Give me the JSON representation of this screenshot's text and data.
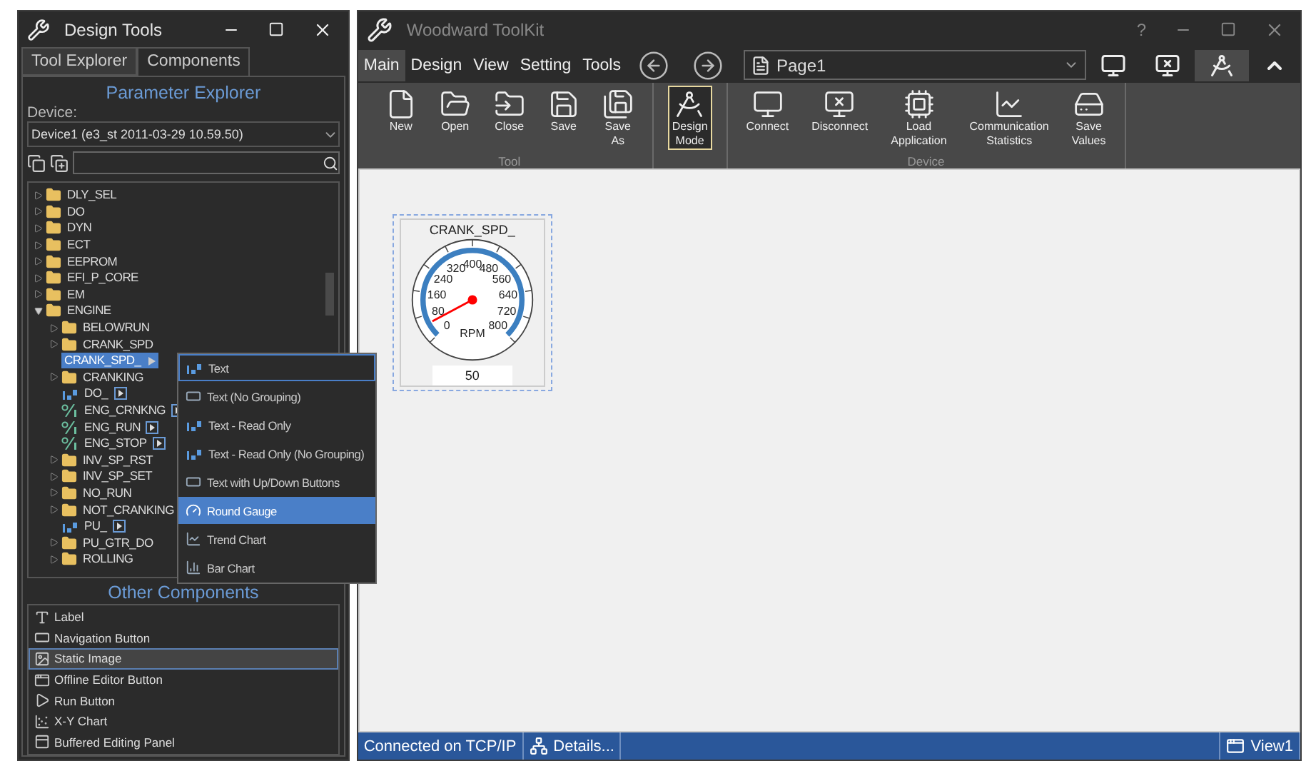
{
  "design_tools": {
    "title": "Design Tools",
    "tabs": [
      {
        "label": "Tool Explorer",
        "selected": false
      },
      {
        "label": "Components",
        "selected": true
      }
    ],
    "heading": "Parameter Explorer",
    "device_label": "Device:",
    "device": "Device1 (e3_st 2011-03-29 10.59.50)",
    "tree": [
      {
        "label": "DLY_SEL",
        "kind": "folder",
        "expanded": false,
        "selected": false
      },
      {
        "label": "DO",
        "kind": "folder",
        "expanded": false,
        "selected": false
      },
      {
        "label": "DYN",
        "kind": "folder",
        "expanded": false,
        "selected": false
      },
      {
        "label": "ECT",
        "kind": "folder",
        "expanded": false,
        "selected": false
      },
      {
        "label": "EEPROM",
        "kind": "folder",
        "expanded": false,
        "selected": false
      },
      {
        "label": "EFI_P_CORE",
        "kind": "folder",
        "expanded": false,
        "selected": false
      },
      {
        "label": "EM",
        "kind": "folder",
        "expanded": false,
        "selected": false
      },
      {
        "label": "ENGINE",
        "kind": "folder",
        "expanded": true,
        "selected": false,
        "children": [
          {
            "label": "BELOWRUN",
            "kind": "folder",
            "expanded": false,
            "selected": false
          },
          {
            "label": "CRANK_SPD",
            "kind": "folder",
            "expanded": false,
            "selected": false
          },
          {
            "label": "CRANK_SPD_",
            "kind": "numeric",
            "selected": true
          },
          {
            "label": "CRANKING",
            "kind": "folder",
            "expanded": false,
            "selected": false
          },
          {
            "label": "DO_",
            "kind": "numeric",
            "selected": false
          },
          {
            "label": "ENG_CRNKNG",
            "kind": "boolean",
            "selected": false
          },
          {
            "label": "ENG_RUN",
            "kind": "boolean",
            "selected": false
          },
          {
            "label": "ENG_STOP",
            "kind": "boolean",
            "selected": false
          },
          {
            "label": "INV_SP_RST",
            "kind": "folder",
            "expanded": false,
            "selected": false
          },
          {
            "label": "INV_SP_SET",
            "kind": "folder",
            "expanded": false,
            "selected": false
          },
          {
            "label": "NO_RUN",
            "kind": "folder",
            "expanded": false,
            "selected": false
          },
          {
            "label": "NOT_CRANKING",
            "kind": "folder",
            "expanded": false,
            "selected": false
          },
          {
            "label": "PU_",
            "kind": "numeric",
            "selected": false
          },
          {
            "label": "PU_GTR_DO",
            "kind": "folder",
            "expanded": false,
            "selected": false
          },
          {
            "label": "ROLLING",
            "kind": "folder",
            "expanded": false,
            "selected": false
          }
        ]
      }
    ],
    "context_menu": [
      {
        "label": "Text",
        "kind": "numeric",
        "selected": false,
        "focused": true
      },
      {
        "label": "Text (No Grouping)",
        "kind": "field",
        "selected": false,
        "focused": false
      },
      {
        "label": "Text - Read Only",
        "kind": "numeric",
        "selected": false,
        "focused": false
      },
      {
        "label": "Text - Read Only (No Grouping)",
        "kind": "numeric",
        "selected": false,
        "focused": false
      },
      {
        "label": "Text with Up/Down Buttons",
        "kind": "field",
        "selected": false,
        "focused": false
      },
      {
        "label": "Round Gauge",
        "kind": "gauge",
        "selected": true,
        "focused": false
      },
      {
        "label": "Trend Chart",
        "kind": "trend",
        "selected": false,
        "focused": false
      },
      {
        "label": "Bar Chart",
        "kind": "bar",
        "selected": false,
        "focused": false
      }
    ],
    "other_heading": "Other Components",
    "other_components": [
      {
        "label": "Label",
        "kind": "label",
        "selected": false
      },
      {
        "label": "Navigation Button",
        "kind": "nav",
        "selected": false
      },
      {
        "label": "Static Image",
        "kind": "image",
        "selected": true
      },
      {
        "label": "Offline Editor Button",
        "kind": "window",
        "selected": false
      },
      {
        "label": "Run Button",
        "kind": "run",
        "selected": false
      },
      {
        "label": "X-Y Chart",
        "kind": "xy",
        "selected": false
      },
      {
        "label": "Buffered Editing Panel",
        "kind": "panel",
        "selected": false
      }
    ]
  },
  "toolkit": {
    "title": "Woodward ToolKit",
    "help": "?",
    "menu": [
      {
        "label": "Main",
        "selected": true
      },
      {
        "label": "Design",
        "selected": false
      },
      {
        "label": "View",
        "selected": false
      },
      {
        "label": "Setting",
        "selected": false
      },
      {
        "label": "Tools",
        "selected": false
      }
    ],
    "page": "Page1",
    "groups": [
      {
        "label": "Tool",
        "buttons": [
          {
            "label": "New",
            "kind": "new",
            "active": false
          },
          {
            "label": "Open",
            "kind": "open",
            "active": false
          },
          {
            "label": "Close",
            "kind": "close",
            "active": false
          },
          {
            "label": "Save",
            "kind": "save",
            "active": false
          },
          {
            "label": "Save As",
            "kind": "saveas",
            "active": false
          }
        ]
      },
      {
        "buttons": [
          {
            "label": "Design Mode",
            "kind": "design",
            "active": true
          }
        ]
      },
      {
        "label": "Device",
        "buttons": [
          {
            "label": "Connect",
            "kind": "connect",
            "active": false
          },
          {
            "label": "Disconnect",
            "kind": "disconnect",
            "active": false
          },
          {
            "label": "Load Application",
            "kind": "load",
            "active": false
          },
          {
            "label": "Communication Statistics",
            "kind": "stats",
            "active": false
          },
          {
            "label": "Save Values",
            "kind": "values",
            "active": false
          }
        ]
      }
    ],
    "gauge": {
      "title": "CRANK_SPD_",
      "scale": [
        "400",
        "320",
        "480",
        "240",
        "560",
        "160",
        "640",
        "80",
        "720",
        "0",
        "800"
      ],
      "unit": "RPM",
      "value": "50"
    },
    "status": {
      "connection": "Connected on TCP/IP",
      "details": "Details...",
      "view": "View1"
    }
  }
}
